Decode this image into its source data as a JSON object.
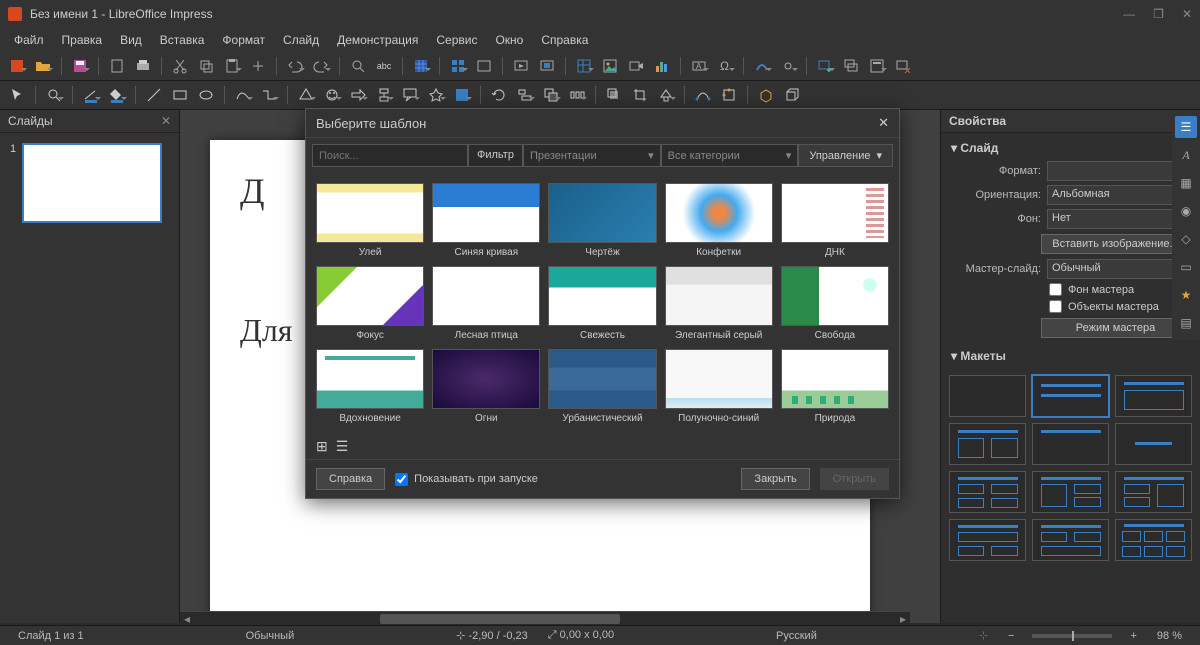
{
  "window": {
    "title": "Без имени 1 - LibreOffice Impress"
  },
  "menu": [
    "Файл",
    "Правка",
    "Вид",
    "Вставка",
    "Формат",
    "Слайд",
    "Демонстрация",
    "Сервис",
    "Окно",
    "Справка"
  ],
  "slides_panel": {
    "title": "Слайды",
    "items": [
      {
        "num": "1"
      }
    ]
  },
  "canvas": {
    "title_placeholder_partial1": "Д",
    "title_placeholder_partial2": "Для"
  },
  "properties": {
    "header": "Свойства",
    "slide": {
      "section": "Слайд",
      "format_label": "Формат:",
      "format_value": "",
      "orientation_label": "Ориентация:",
      "orientation_value": "Альбомная",
      "background_label": "Фон:",
      "background_value": "Нет",
      "insert_image": "Вставить изображение...",
      "master_label": "Мастер-слайд:",
      "master_value": "Обычный",
      "master_bg": "Фон мастера",
      "master_objects": "Объекты мастера",
      "master_mode": "Режим мастера"
    },
    "layouts_section": "Макеты"
  },
  "dialog": {
    "title": "Выберите шаблон",
    "search_placeholder": "Поиск...",
    "filter_label": "Фильтр",
    "filter_app": "Презентации",
    "filter_category": "Все категории",
    "manage_btn": "Управление",
    "templates": [
      {
        "name": "Улей",
        "cls": "th-a"
      },
      {
        "name": "Синяя кривая",
        "cls": "th-b"
      },
      {
        "name": "Чертёж",
        "cls": "th-c"
      },
      {
        "name": "Конфетки",
        "cls": "th-d"
      },
      {
        "name": "ДНК",
        "cls": "th-e"
      },
      {
        "name": "Фокус",
        "cls": "th-f"
      },
      {
        "name": "Лесная птица",
        "cls": "th-g"
      },
      {
        "name": "Свежесть",
        "cls": "th-h"
      },
      {
        "name": "Элегантный серый",
        "cls": "th-i"
      },
      {
        "name": "Свобода",
        "cls": "th-j"
      },
      {
        "name": "Вдохновение",
        "cls": "th-k"
      },
      {
        "name": "Огни",
        "cls": "th-l"
      },
      {
        "name": "Урбанистический",
        "cls": "th-m"
      },
      {
        "name": "Полуночно-синий",
        "cls": "th-o"
      },
      {
        "name": "Природа",
        "cls": "th-n"
      }
    ],
    "help_btn": "Справка",
    "show_on_start": "Показывать при запуске",
    "close_btn": "Закрыть",
    "open_btn": "Открыть"
  },
  "statusbar": {
    "slide_count": "Слайд 1 из 1",
    "view": "Обычный",
    "coords": "-2,90 / -0,23",
    "size": "0,00 x 0,00",
    "lang": "Русский",
    "zoom": "98 %"
  }
}
